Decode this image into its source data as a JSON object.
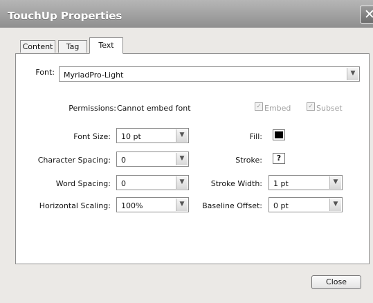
{
  "window": {
    "title": "TouchUp Properties",
    "close_glyph": "✕"
  },
  "tabs": [
    {
      "label": "Content"
    },
    {
      "label": "Tag"
    },
    {
      "label": "Text"
    }
  ],
  "text_tab": {
    "font": {
      "label": "Font:",
      "value": "MyriadPro-Light"
    },
    "permissions": {
      "label": "Permissions:",
      "value": "Cannot embed font"
    },
    "embed": {
      "label": "Embed",
      "checked": true
    },
    "subset": {
      "label": "Subset",
      "checked": true
    },
    "font_size": {
      "label": "Font Size:",
      "value": "10 pt"
    },
    "character_spacing": {
      "label": "Character Spacing:",
      "value": "0"
    },
    "word_spacing": {
      "label": "Word Spacing:",
      "value": "0"
    },
    "horizontal_scaling": {
      "label": "Horizontal Scaling:",
      "value": "100%"
    },
    "fill": {
      "label": "Fill:",
      "color": "#000000"
    },
    "stroke": {
      "label": "Stroke:",
      "value": "?"
    },
    "stroke_width": {
      "label": "Stroke Width:",
      "value": "1 pt"
    },
    "baseline_offset": {
      "label": "Baseline Offset:",
      "value": "0 pt"
    }
  },
  "footer": {
    "close_label": "Close"
  }
}
